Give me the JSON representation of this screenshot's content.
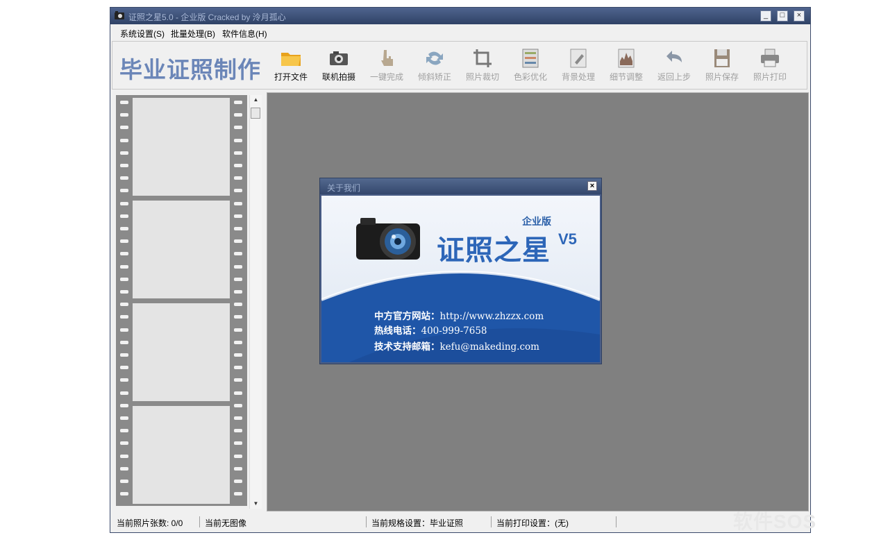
{
  "window": {
    "title": "证照之星5.0 - 企业版 Cracked by 泠月孤心",
    "buttons": {
      "minimize": "_",
      "maximize": "□",
      "close": "×"
    }
  },
  "menu": {
    "items": [
      {
        "label": "系统设置(S)"
      },
      {
        "label": "批量处理(B)"
      },
      {
        "label": "软件信息(H)"
      }
    ]
  },
  "toolbar": {
    "brand": "毕业证照制作",
    "tools": [
      {
        "label": "打开文件",
        "icon": "folder-icon",
        "enabled": true
      },
      {
        "label": "联机拍摄",
        "icon": "camera-icon",
        "enabled": true
      },
      {
        "label": "一键完成",
        "icon": "hand-pointer-icon",
        "enabled": false
      },
      {
        "label": "倾斜矫正",
        "icon": "rotate-icon",
        "enabled": false
      },
      {
        "label": "照片裁切",
        "icon": "crop-icon",
        "enabled": false
      },
      {
        "label": "色彩优化",
        "icon": "color-sliders-icon",
        "enabled": false
      },
      {
        "label": "背景处理",
        "icon": "background-brush-icon",
        "enabled": false
      },
      {
        "label": "细节调整",
        "icon": "histogram-icon",
        "enabled": false
      },
      {
        "label": "返回上步",
        "icon": "undo-icon",
        "enabled": false
      },
      {
        "label": "照片保存",
        "icon": "floppy-disk-icon",
        "enabled": false
      },
      {
        "label": "照片打印",
        "icon": "printer-icon",
        "enabled": false
      }
    ]
  },
  "filmstrip": {
    "frame_count": 4
  },
  "status": {
    "photo_count": "当前照片张数: 0/0",
    "current_image": "当前无图像",
    "spec": "当前规格设置：毕业证照",
    "print": "当前打印设置：(无)"
  },
  "about_dialog": {
    "title": "关于我们",
    "edition": "企业版",
    "product": "证照之星",
    "version": "V5",
    "website_label": "中方官方网站：",
    "website": "http://www.zhzzx.com",
    "hotline_label": "热线电话：",
    "hotline": "400-999-7658",
    "email_label": "技术支持邮箱：",
    "email": "kefu@makeding.com"
  },
  "watermark": "软件SOS",
  "colors": {
    "titlebar": "#3a4d74",
    "brand_text": "#6b86b8",
    "workarea": "#808080",
    "dialog_accent": "#2d66b8"
  }
}
